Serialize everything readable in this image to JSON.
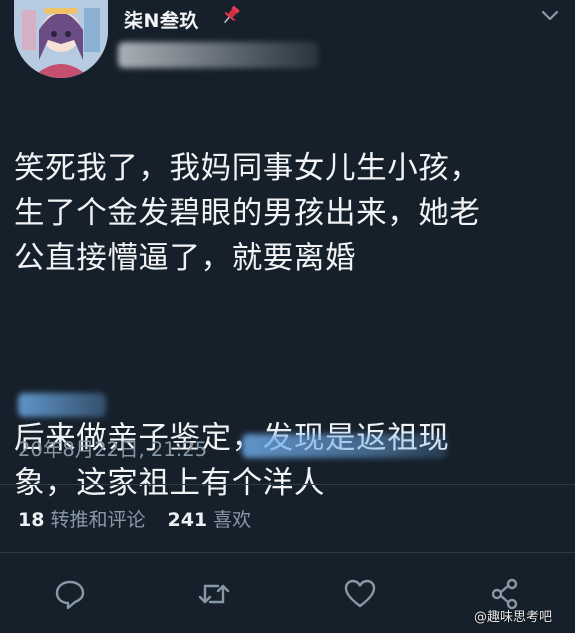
{
  "user": {
    "display_name": "柒N叁玖",
    "pin_icon": "pushpin-icon"
  },
  "tweet": {
    "paragraph1": "笑死我了，我妈同事女儿生小孩，\n生了个金发碧眼的男孩出来，她老\n公直接懵逼了，就要离婚",
    "paragraph2": "后来做亲子鉴定，发现是返祖现\n象，这家祖上有个洋人",
    "timestamp": "20年8月22日, 21:25"
  },
  "stats": {
    "retweets_count": "18",
    "retweets_label": "转推和评论",
    "likes_count": "241",
    "likes_label": "喜欢"
  },
  "actions": {
    "reply_icon": "comment-icon",
    "retweet_icon": "retweet-icon",
    "like_icon": "heart-icon",
    "share_icon": "share-icon"
  },
  "watermark": "@趣味思考吧",
  "colors": {
    "background": "#16202b",
    "text": "#f1f3f5",
    "secondary_text": "#8899a6",
    "divider": "#2d3a47"
  }
}
